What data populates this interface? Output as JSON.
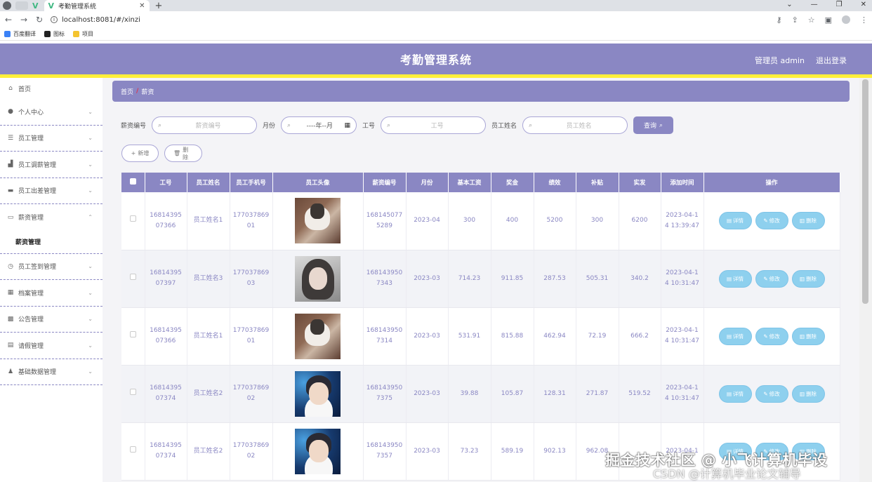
{
  "browser": {
    "tab_title": "考勤管理系统",
    "url": "localhost:8081/#/xinzi",
    "bookmarks": [
      "百度翻译",
      "图标",
      "项目"
    ]
  },
  "header": {
    "title": "考勤管理系统",
    "user_label": "管理员 admin",
    "logout": "退出登录",
    "color": "#8a87c3",
    "accent_bar": "#ffef3a"
  },
  "sidebar": {
    "items": [
      {
        "label": "首页",
        "icon": "home-icon"
      },
      {
        "label": "个人中心",
        "icon": "user-icon"
      },
      {
        "label": "员工管理",
        "icon": "list-icon"
      },
      {
        "label": "员工调薪管理",
        "icon": "chart-icon"
      },
      {
        "label": "员工出差管理",
        "icon": "board-icon"
      },
      {
        "label": "薪资管理",
        "icon": "message-icon"
      },
      {
        "label": "员工签到管理",
        "icon": "clock-icon"
      },
      {
        "label": "档案管理",
        "icon": "folder-icon"
      },
      {
        "label": "公告管理",
        "icon": "notice-icon"
      },
      {
        "label": "请假管理",
        "icon": "doc-icon"
      },
      {
        "label": "基础数据管理",
        "icon": "person-icon"
      }
    ],
    "submenu_label": "薪资管理"
  },
  "breadcrumb": {
    "home": "首页",
    "separator": "/",
    "current": "薪资"
  },
  "search": {
    "f1_label": "薪资编号",
    "f1_placeholder": "薪资编号",
    "f2_label": "月份",
    "f2_value": "----年--月",
    "f3_label": "工号",
    "f3_placeholder": "工号",
    "f4_label": "员工姓名",
    "f4_placeholder": "员工姓名",
    "query_button": "查询"
  },
  "actions": {
    "add": "新增",
    "delete": "删除"
  },
  "table": {
    "columns": [
      "工号",
      "员工姓名",
      "员工手机号",
      "员工头像",
      "薪资编号",
      "月份",
      "基本工资",
      "奖金",
      "绩效",
      "补贴",
      "实发",
      "添加时间",
      "操作"
    ],
    "op_labels": {
      "detail": "详情",
      "edit": "修改",
      "delete": "删除"
    },
    "rows": [
      {
        "emp_no": "1681439507366",
        "name": "员工姓名1",
        "phone": "17703786901",
        "avatar": "cat",
        "salary_no": "1681450775289",
        "month": "2023-04",
        "base": "300",
        "bonus": "400",
        "perf": "5200",
        "allowance": "300",
        "actual": "6200",
        "added": "2023-04-14 13:39:47"
      },
      {
        "emp_no": "1681439507397",
        "name": "员工姓名3",
        "phone": "17703786903",
        "avatar": "girl",
        "salary_no": "1681439507343",
        "month": "2023-03",
        "base": "714.23",
        "bonus": "911.85",
        "perf": "287.53",
        "allowance": "505.31",
        "actual": "340.2",
        "added": "2023-04-14 10:31:47"
      },
      {
        "emp_no": "1681439507366",
        "name": "员工姓名1",
        "phone": "17703786901",
        "avatar": "cat",
        "salary_no": "1681439507314",
        "month": "2023-03",
        "base": "531.91",
        "bonus": "815.88",
        "perf": "462.94",
        "allowance": "72.19",
        "actual": "666.2",
        "added": "2023-04-14 10:31:47"
      },
      {
        "emp_no": "1681439507374",
        "name": "员工姓名2",
        "phone": "17703786902",
        "avatar": "boy",
        "salary_no": "1681439507375",
        "month": "2023-03",
        "base": "39.88",
        "bonus": "105.87",
        "perf": "128.31",
        "allowance": "271.87",
        "actual": "519.52",
        "added": "2023-04-14 10:31:47"
      },
      {
        "emp_no": "1681439507374",
        "name": "员工姓名2",
        "phone": "17703786902",
        "avatar": "boy",
        "salary_no": "1681439507357",
        "month": "2023-03",
        "base": "73.23",
        "bonus": "589.19",
        "perf": "902.13",
        "allowance": "962.08",
        "actual": "",
        "added": "2023-04-1"
      }
    ]
  },
  "watermark": {
    "line1": "掘金技术社区 @ 小飞计算机毕设",
    "line2": "CSDN @计算机毕业论文辅导"
  }
}
